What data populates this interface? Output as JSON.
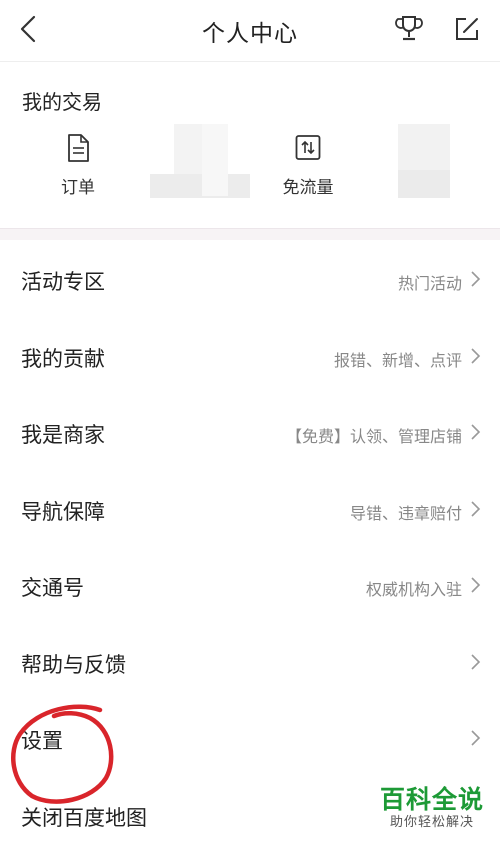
{
  "header": {
    "title": "个人中心",
    "back_icon": "back-arrow-icon",
    "trophy_icon": "trophy-icon",
    "edit_icon": "edit-icon"
  },
  "transactions": {
    "title": "我的交易",
    "items": [
      {
        "label": "订单",
        "icon": "document-icon"
      },
      {
        "label": "免流量",
        "icon": "data-swap-icon"
      }
    ]
  },
  "menu": [
    {
      "label": "活动专区",
      "hint": "热门活动"
    },
    {
      "label": "我的贡献",
      "hint": "报错、新增、点评"
    },
    {
      "label": "我是商家",
      "hint": "【免费】认领、管理店铺"
    },
    {
      "label": "导航保障",
      "hint": "导错、违章赔付"
    },
    {
      "label": "交通号",
      "hint": "权威机构入驻"
    },
    {
      "label": "帮助与反馈",
      "hint": ""
    },
    {
      "label": "设置",
      "hint": ""
    },
    {
      "label": "关闭百度地图",
      "hint": ""
    }
  ],
  "watermark": {
    "main": "百科全说",
    "sub": "助你轻松解决"
  },
  "colors": {
    "annotation_red": "#d9252b",
    "watermark_green": "#1d9a36",
    "hint_gray": "#888888"
  }
}
